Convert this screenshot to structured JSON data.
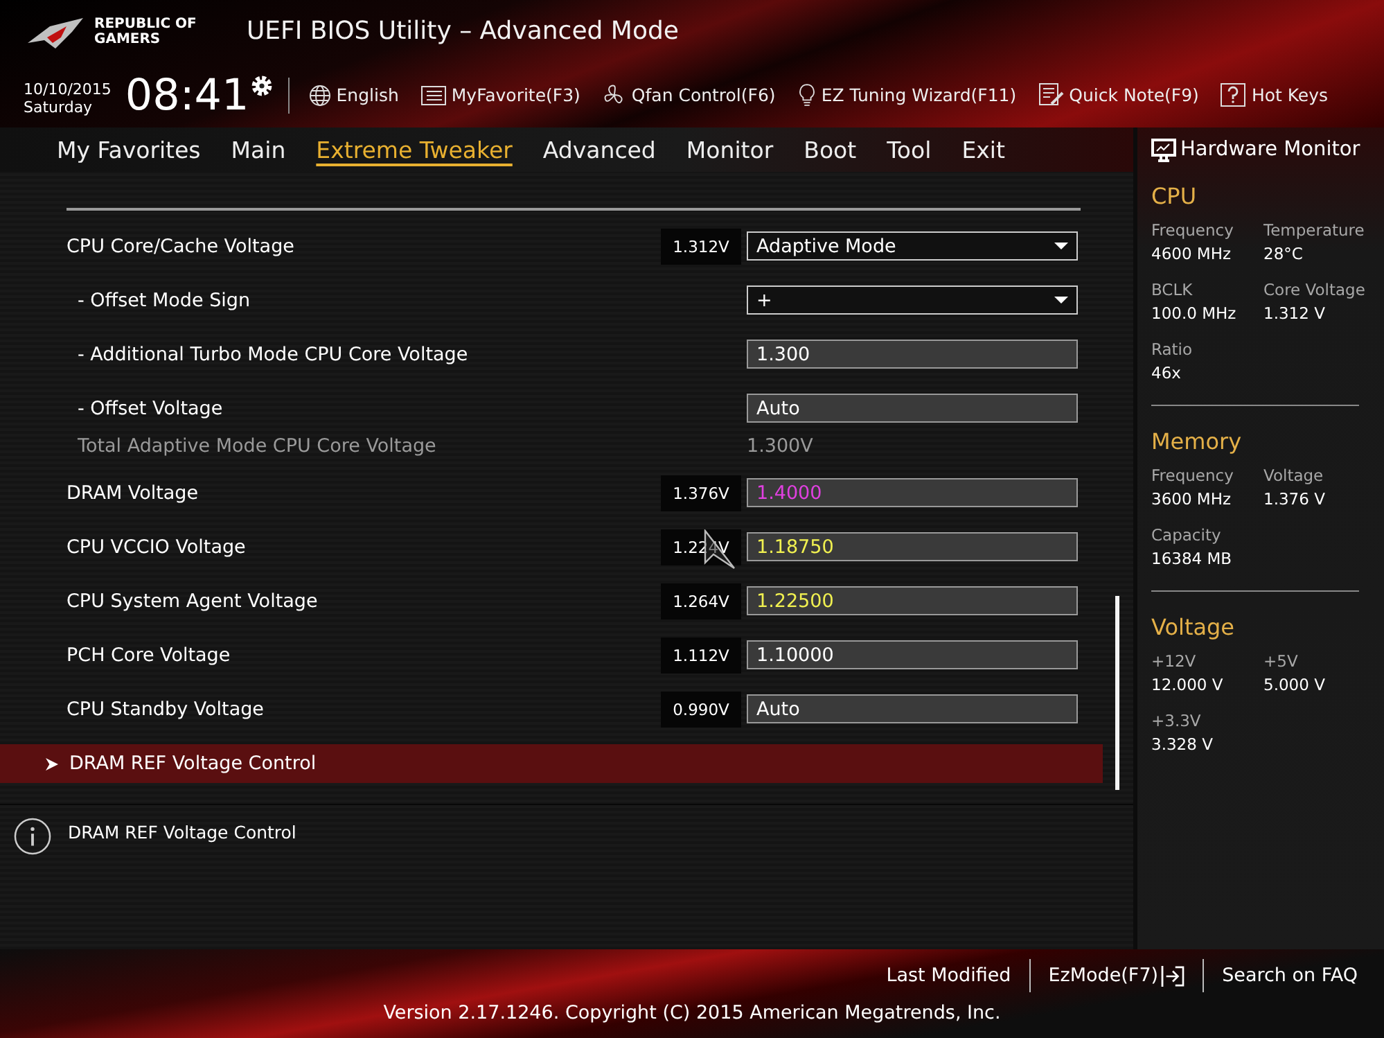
{
  "header": {
    "brand": [
      "REPUBLIC OF",
      "GAMERS"
    ],
    "title": "UEFI BIOS Utility – Advanced Mode"
  },
  "datetime": {
    "date": "10/10/2015",
    "day": "Saturday",
    "time": "08:41"
  },
  "toolbar": [
    {
      "label": "English",
      "kind": "globe"
    },
    {
      "label": "MyFavorite(F3)",
      "kind": "list"
    },
    {
      "label": "Qfan Control(F6)",
      "kind": "fan"
    },
    {
      "label": "EZ Tuning Wizard(F11)",
      "kind": "bulb"
    },
    {
      "label": "Quick Note(F9)",
      "kind": "note"
    },
    {
      "label": "Hot Keys",
      "kind": "help"
    }
  ],
  "tabs": [
    {
      "label": "My Favorites",
      "selected": false
    },
    {
      "label": "Main",
      "selected": false
    },
    {
      "label": "Extreme Tweaker",
      "selected": true
    },
    {
      "label": "Advanced",
      "selected": false
    },
    {
      "label": "Monitor",
      "selected": false
    },
    {
      "label": "Boot",
      "selected": false
    },
    {
      "label": "Tool",
      "selected": false
    },
    {
      "label": "Exit",
      "selected": false
    }
  ],
  "settings": [
    {
      "label": "CPU Core/Cache Voltage",
      "reading": "1.312V",
      "kind": "dropdown",
      "value": "Adaptive Mode",
      "color": "#ffffff",
      "children": [
        {
          "label": "- Offset Mode Sign",
          "kind": "dropdown",
          "value": "+",
          "color": "#ffffff"
        },
        {
          "label": "- Additional Turbo Mode CPU Core Voltage",
          "kind": "input",
          "value": "1.300",
          "color": "#ffffff"
        },
        {
          "label": "- Offset Voltage",
          "kind": "input",
          "value": "Auto",
          "color": "#ffffff"
        },
        {
          "label": "Total Adaptive Mode CPU Core Voltage",
          "kind": "info",
          "value": "1.300V",
          "color": "#9a9a9a"
        }
      ]
    },
    {
      "label": "DRAM Voltage",
      "reading": "1.376V",
      "kind": "input",
      "value": "1.4000",
      "color": "#e040e0"
    },
    {
      "label": "CPU VCCIO Voltage",
      "reading": "1.224V",
      "kind": "input",
      "value": "1.18750",
      "color": "#f0f050"
    },
    {
      "label": "CPU System Agent Voltage",
      "reading": "1.264V",
      "kind": "input",
      "value": "1.22500",
      "color": "#f0f050"
    },
    {
      "label": "PCH Core Voltage",
      "reading": "1.112V",
      "kind": "input",
      "value": "1.10000",
      "color": "#ffffff"
    },
    {
      "label": "CPU Standby Voltage",
      "reading": "0.990V",
      "kind": "input",
      "value": "Auto",
      "color": "#ffffff"
    }
  ],
  "submenu": {
    "label": "DRAM REF Voltage Control",
    "selected": true
  },
  "help": {
    "text": "DRAM REF Voltage Control"
  },
  "hardware_monitor": {
    "title": "Hardware Monitor",
    "groups": [
      {
        "title": "CPU",
        "items": [
          {
            "label": "Frequency",
            "value": "4600 MHz"
          },
          {
            "label": "Temperature",
            "value": "28°C"
          },
          {
            "label": "BCLK",
            "value": "100.0 MHz"
          },
          {
            "label": "Core Voltage",
            "value": "1.312 V"
          },
          {
            "label": "Ratio",
            "value": "46x"
          }
        ]
      },
      {
        "title": "Memory",
        "items": [
          {
            "label": "Frequency",
            "value": "3600 MHz"
          },
          {
            "label": "Voltage",
            "value": "1.376 V"
          },
          {
            "label": "Capacity",
            "value": "16384 MB"
          }
        ]
      },
      {
        "title": "Voltage",
        "items": [
          {
            "label": "+12V",
            "value": "12.000 V"
          },
          {
            "label": "+5V",
            "value": "5.000 V"
          },
          {
            "label": "+3.3V",
            "value": "3.328 V"
          }
        ]
      }
    ]
  },
  "footer": {
    "links": [
      "Last Modified",
      "EzMode(F7)",
      "Search on FAQ"
    ],
    "version": "Version 2.17.1246. Copyright (C) 2015 American Megatrends, Inc."
  }
}
